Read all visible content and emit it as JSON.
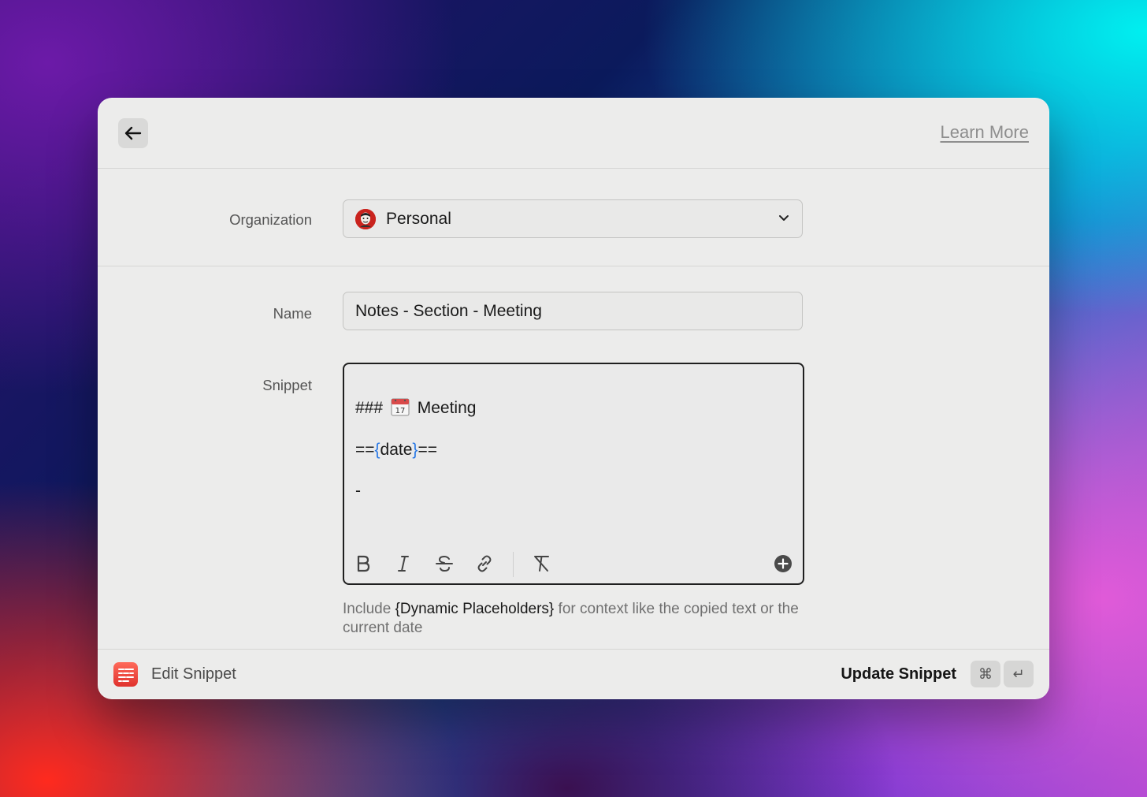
{
  "header": {
    "learn_more": "Learn More"
  },
  "organization": {
    "label": "Organization",
    "selected": "Personal"
  },
  "name": {
    "label": "Name",
    "value": "Notes - Section - Meeting"
  },
  "snippet": {
    "label": "Snippet",
    "heading_prefix": "###",
    "heading_text": "Meeting",
    "date_line": {
      "open": "==",
      "brace_open": "{",
      "placeholder": "date",
      "brace_close": "}",
      "close": "=="
    },
    "bullet": "-",
    "calendar_emoji_day": "17"
  },
  "helper": {
    "text_before": "Include ",
    "placeholder_text": "{Dynamic Placeholders}",
    "text_after": " for context like the copied text or the current date"
  },
  "footer": {
    "title": "Edit Snippet",
    "action": "Update Snippet",
    "shortcut_cmd": "⌘",
    "shortcut_enter": "↵"
  },
  "colors": {
    "placeholder_brace": "#2878e6",
    "app_icon": "#e0322d"
  },
  "icons": [
    "arrow-left-icon",
    "chevron-down-icon",
    "bold-icon",
    "italic-icon",
    "strikethrough-icon",
    "link-icon",
    "clear-format-icon",
    "plus-circle-icon",
    "snippet-app-icon",
    "calendar-emoji-icon"
  ]
}
